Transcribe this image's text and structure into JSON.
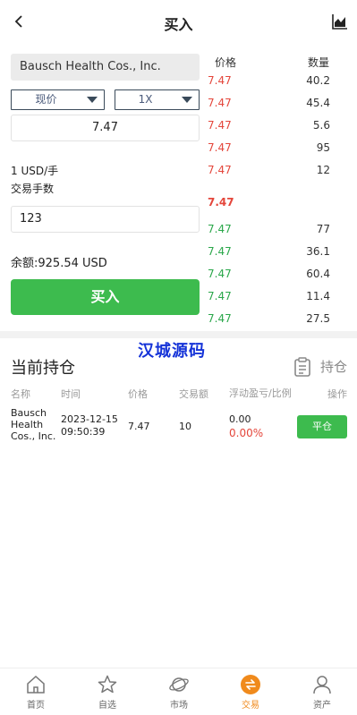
{
  "header": {
    "title": "买入",
    "back_icon": "chevron-left-icon",
    "chart_icon": "area-chart-icon"
  },
  "form": {
    "stock_name": "Bausch Health Cos., Inc.",
    "order_type": "现价",
    "leverage": "1X",
    "price": "7.47",
    "lot_info": "1 USD/手",
    "fee_label": "交易手数",
    "quantity": "123",
    "balance": "余额:925.54 USD",
    "buy_label": "买入"
  },
  "orderbook": {
    "price_header": "价格",
    "qty_header": "数量",
    "asks": [
      {
        "price": "7.47",
        "qty": "40.2"
      },
      {
        "price": "7.47",
        "qty": "45.4"
      },
      {
        "price": "7.47",
        "qty": "5.6"
      },
      {
        "price": "7.47",
        "qty": "95"
      },
      {
        "price": "7.47",
        "qty": "12"
      }
    ],
    "current": "7.47",
    "bids": [
      {
        "price": "7.47",
        "qty": "77"
      },
      {
        "price": "7.47",
        "qty": "36.1"
      },
      {
        "price": "7.47",
        "qty": "60.4"
      },
      {
        "price": "7.47",
        "qty": "11.4"
      },
      {
        "price": "7.47",
        "qty": "27.5"
      }
    ]
  },
  "watermark": "汉城源码",
  "positions": {
    "title": "当前持仓",
    "link_label": "持仓",
    "columns": {
      "name": "名称",
      "time": "时间",
      "price": "价格",
      "amount": "交易额",
      "pnl": "浮动盈亏/比例",
      "op": "操作"
    },
    "row": {
      "name": "Bausch Health Cos., Inc.",
      "time": "2023-12-15 09:50:39",
      "price": "7.47",
      "amount": "10",
      "pnl": "0.00",
      "ratio": "0.00%",
      "close_label": "平仓"
    }
  },
  "tabs": [
    {
      "label": "首页",
      "icon": "home-icon"
    },
    {
      "label": "自选",
      "icon": "star-icon"
    },
    {
      "label": "市场",
      "icon": "planet-icon"
    },
    {
      "label": "交易",
      "icon": "trade-icon"
    },
    {
      "label": "资产",
      "icon": "user-icon"
    }
  ],
  "colors": {
    "buy_green": "#3dbb4e",
    "ask_red": "#e4463b",
    "bid_green": "#2aa74a",
    "active_tab": "#f08a1c",
    "watermark": "#1533d8"
  }
}
